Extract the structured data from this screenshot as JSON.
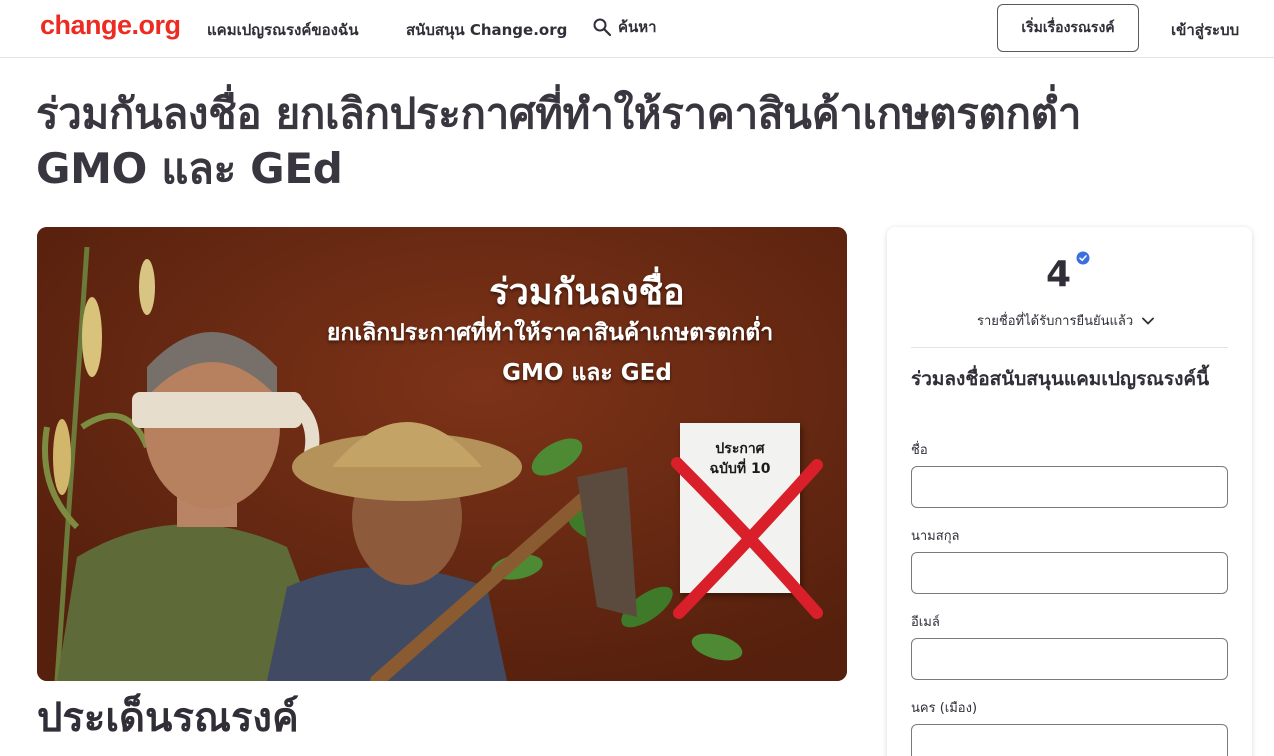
{
  "header": {
    "logo": "change.org",
    "nav_my_campaigns": "แคมเปญรณรงค์ของฉัน",
    "nav_support": "สนับสนุน Change.org",
    "nav_search": "ค้นหา",
    "start_button": "เริ่มเรื่องรณรงค์",
    "login": "เข้าสู่ระบบ"
  },
  "petition": {
    "title": "ร่วมกันลงชื่อ ยกเลิกประกาศที่ทำให้ราคาสินค้าเกษตรตกต่ำ GMO และ GEd",
    "hero": {
      "line1": "ร่วมกันลงชื่อ",
      "line2": "ยกเลิกประกาศที่ทำให้ราคาสินค้าเกษตรตกต่ำ",
      "line3": "GMO และ GEd",
      "notice_line1": "ประกาศ",
      "notice_line2": "ฉบับที่ 10"
    },
    "section_heading": "ประเด็นรณรงค์"
  },
  "sidebar": {
    "signature_count": "4",
    "verified_label": "รายชื่อที่ได้รับการยืนยันแล้ว",
    "form_title": "ร่วมลงชื่อสนับสนุนแคมเปญรณรงค์นี้",
    "fields": [
      {
        "label": "ชื่อ",
        "value": ""
      },
      {
        "label": "นามสกุล",
        "value": ""
      },
      {
        "label": "อีเมล์",
        "value": ""
      },
      {
        "label": "นคร (เมือง)",
        "value": ""
      }
    ]
  },
  "colors": {
    "brand": "#ec2c22",
    "text": "#312e38",
    "verified": "#3a6fe0",
    "hero_background": "#6b2b14"
  },
  "icons": [
    "search-icon",
    "verified-check-icon",
    "chevron-down-icon"
  ]
}
